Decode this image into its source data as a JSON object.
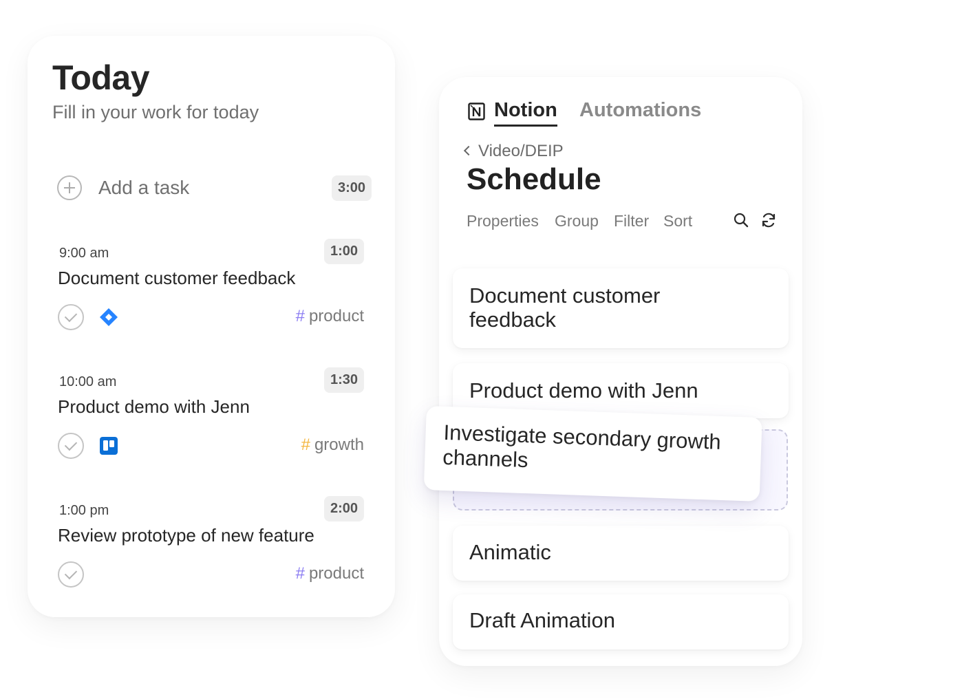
{
  "today": {
    "title": "Today",
    "subtitle": "Fill in your work for today",
    "add_task_label": "Add a task",
    "add_task_duration": "3:00",
    "tasks": [
      {
        "time": "9:00 am",
        "duration": "1:00",
        "title": "Document customer feedback",
        "app_icon": "jira-icon",
        "tag": "product",
        "tag_color": "#8b7cf2"
      },
      {
        "time": "10:00 am",
        "duration": "1:30",
        "title": "Product demo with Jenn",
        "app_icon": "trello-icon",
        "tag": "growth",
        "tag_color": "#f4b63f"
      },
      {
        "time": "1:00 pm",
        "duration": "2:00",
        "title": "Review prototype of new feature",
        "app_icon": "",
        "tag": "product",
        "tag_color": "#8b7cf2"
      }
    ]
  },
  "notion": {
    "tabs": [
      "Notion",
      "Automations"
    ],
    "breadcrumb": "Video/DEIP",
    "title": "Schedule",
    "toolbar": [
      "Properties",
      "Group",
      "Filter",
      "Sort"
    ],
    "rows": [
      "Document customer feedback",
      "Product demo with Jenn",
      "Animatic",
      "Draft Animation"
    ],
    "dragging_item": "Investigate secondary growth channels"
  },
  "colors": {
    "jira_blue": "#2684ff",
    "trello_blue": "#0b6fd6",
    "drop_zone_border": "#c9c8de"
  }
}
